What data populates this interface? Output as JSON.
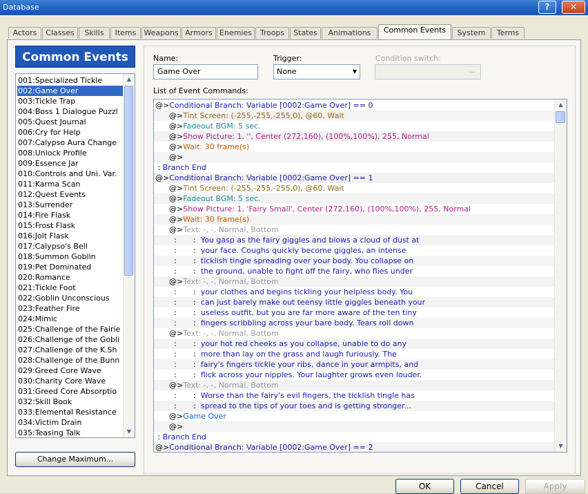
{
  "window": {
    "title": "Database",
    "help_glyph": "?",
    "close_glyph": "✕"
  },
  "tabs": [
    "Actors",
    "Classes",
    "Skills",
    "Items",
    "Weapons",
    "Armors",
    "Enemies",
    "Troops",
    "States",
    "Animations",
    "Common Events",
    "System",
    "Terms"
  ],
  "active_tab": "Common Events",
  "left": {
    "header": "Common Events",
    "selected_index": 1,
    "items": [
      "001:Specialized Tickle",
      "002:Game Over",
      "003:Tickle Trap",
      "004:Boss 1 Dialogue Puzzl",
      "005:Quest Journal",
      "006:Cry for Help",
      "007:Calypso Aura Change",
      "008:Unlock Profile",
      "009:Essence Jar",
      "010:Controls and Uni. Var.",
      "011:Karma Scan",
      "012:Quest Events",
      "013:Surrender",
      "014:Fire Flask",
      "015:Frost Flask",
      "016:Jolt Flask",
      "017:Calypso's Bell",
      "018:Summon Goblin",
      "019:Pet Dominated",
      "020:Romance",
      "021:Tickle Foot",
      "022:Goblin Unconscious",
      "023:Feather Fire",
      "024:Mimic",
      "025:Challenge of the Fairie",
      "026:Challenge of the Gobli",
      "027:Challenge of the K.Sh",
      "028:Challenge of the Bunn",
      "029:Greed Core Wave",
      "030:Charity Core Wave",
      "031:Greed Core Absorptio",
      "032:Skill Book",
      "033:Elemental Resistance",
      "034:Victim Drain",
      "035:Teasing Talk"
    ],
    "change_max_label": "Change Maximum..."
  },
  "form": {
    "name_label": "Name:",
    "name_value": "Game Over",
    "trigger_label": "Trigger:",
    "trigger_value": "None",
    "cond_label": "Condition switch:",
    "cond_dots": "...",
    "list_label": "List of Event Commands:"
  },
  "commands": [
    {
      "i": 0,
      "p": "@>",
      "t": "Conditional Branch: Variable [0002:Game Over] == 0",
      "c": "navy"
    },
    {
      "i": 1,
      "p": "@>",
      "t": "Tint Screen: (-255,-255,-255,0), @60, Wait",
      "c": "brown"
    },
    {
      "i": 1,
      "p": "@>",
      "t": "Fadeout BGM: 5 sec.",
      "c": "teal"
    },
    {
      "i": 1,
      "p": "@>",
      "t": "Show Picture: 1, '', Center (272,160), (100%,100%), 255, Normal",
      "c": "magenta"
    },
    {
      "i": 1,
      "p": "@>",
      "t": "Wait: 30 frame(s)",
      "c": "orange"
    },
    {
      "i": 1,
      "p": "@>",
      "t": "",
      "c": "black"
    },
    {
      "i": 0,
      "p": " : ",
      "t": "Branch End",
      "c": "navy"
    },
    {
      "i": 0,
      "p": "@>",
      "t": "Conditional Branch: Variable [0002:Game Over] == 1",
      "c": "navy"
    },
    {
      "i": 1,
      "p": "@>",
      "t": "Tint Screen: (-255,-255,-255,0), @60, Wait",
      "c": "brown"
    },
    {
      "i": 1,
      "p": "@>",
      "t": "Fadeout BGM: 5 sec.",
      "c": "teal"
    },
    {
      "i": 1,
      "p": "@>",
      "t": "Show Picture: 1, 'Fairy Small', Center (272,160), (100%,100%), 255, Normal",
      "c": "magenta"
    },
    {
      "i": 1,
      "p": "@>",
      "t": "Wait: 30 frame(s)",
      "c": "orange"
    },
    {
      "i": 1,
      "p": "@>",
      "t": "Text: -, -, Normal, Bottom",
      "c": "gray"
    },
    {
      "i": 1,
      "p": "  :       :  ",
      "t": "You gasp as the fairy giggles and blows a cloud of dust at",
      "c": "navy"
    },
    {
      "i": 1,
      "p": "  :       :  ",
      "t": "your face. Coughs quickly become giggles, an intense",
      "c": "navy"
    },
    {
      "i": 1,
      "p": "  :       :  ",
      "t": "ticklish tingle spreading over your body. You collapse on",
      "c": "navy"
    },
    {
      "i": 1,
      "p": "  :       :  ",
      "t": "the ground, unable to fight off the fairy, who flies under",
      "c": "navy"
    },
    {
      "i": 1,
      "p": "@>",
      "t": "Text: -, -, Normal, Bottom",
      "c": "gray"
    },
    {
      "i": 1,
      "p": "  :       :  ",
      "t": "your clothes and begins tickling your helpless body. You",
      "c": "navy"
    },
    {
      "i": 1,
      "p": "  :       :  ",
      "t": "can just barely make out teensy little giggles beneath your",
      "c": "navy"
    },
    {
      "i": 1,
      "p": "  :       :  ",
      "t": "useless outfit, but you are far more aware of the ten tiny",
      "c": "navy"
    },
    {
      "i": 1,
      "p": "  :       :  ",
      "t": "fingers scribbling across your bare body. Tears roll down",
      "c": "navy"
    },
    {
      "i": 1,
      "p": "@>",
      "t": "Text: -, -, Normal, Bottom",
      "c": "gray"
    },
    {
      "i": 1,
      "p": "  :       :  ",
      "t": "your hot red cheeks as you collapse, unable to do any",
      "c": "navy"
    },
    {
      "i": 1,
      "p": "  :       :  ",
      "t": "more than lay on the grass and laugh furiously. The",
      "c": "navy"
    },
    {
      "i": 1,
      "p": "  :       :  ",
      "t": "fairy's fingers tickle your ribs, dance in your armpits, and",
      "c": "navy"
    },
    {
      "i": 1,
      "p": "  :       :  ",
      "t": "flick across your nipples. Your laughter grows even louder.",
      "c": "navy"
    },
    {
      "i": 1,
      "p": "@>",
      "t": "Text: -, -, Normal, Bottom",
      "c": "gray"
    },
    {
      "i": 1,
      "p": "  :       :  ",
      "t": "Worse than the fairy's evil fingers, the ticklish tingle has",
      "c": "navy"
    },
    {
      "i": 1,
      "p": "  :       :  ",
      "t": "spread to the tips of your toes and is getting stronger...",
      "c": "navy"
    },
    {
      "i": 1,
      "p": "@>",
      "t": "Game Over",
      "c": "blue"
    },
    {
      "i": 1,
      "p": "@>",
      "t": "",
      "c": "black"
    },
    {
      "i": 0,
      "p": " : ",
      "t": "Branch End",
      "c": "navy"
    },
    {
      "i": 0,
      "p": "@>",
      "t": "Conditional Branch: Variable [0002:Game Over] == 2",
      "c": "navy"
    }
  ],
  "buttons": {
    "ok": "OK",
    "cancel": "Cancel",
    "apply": "Apply"
  }
}
